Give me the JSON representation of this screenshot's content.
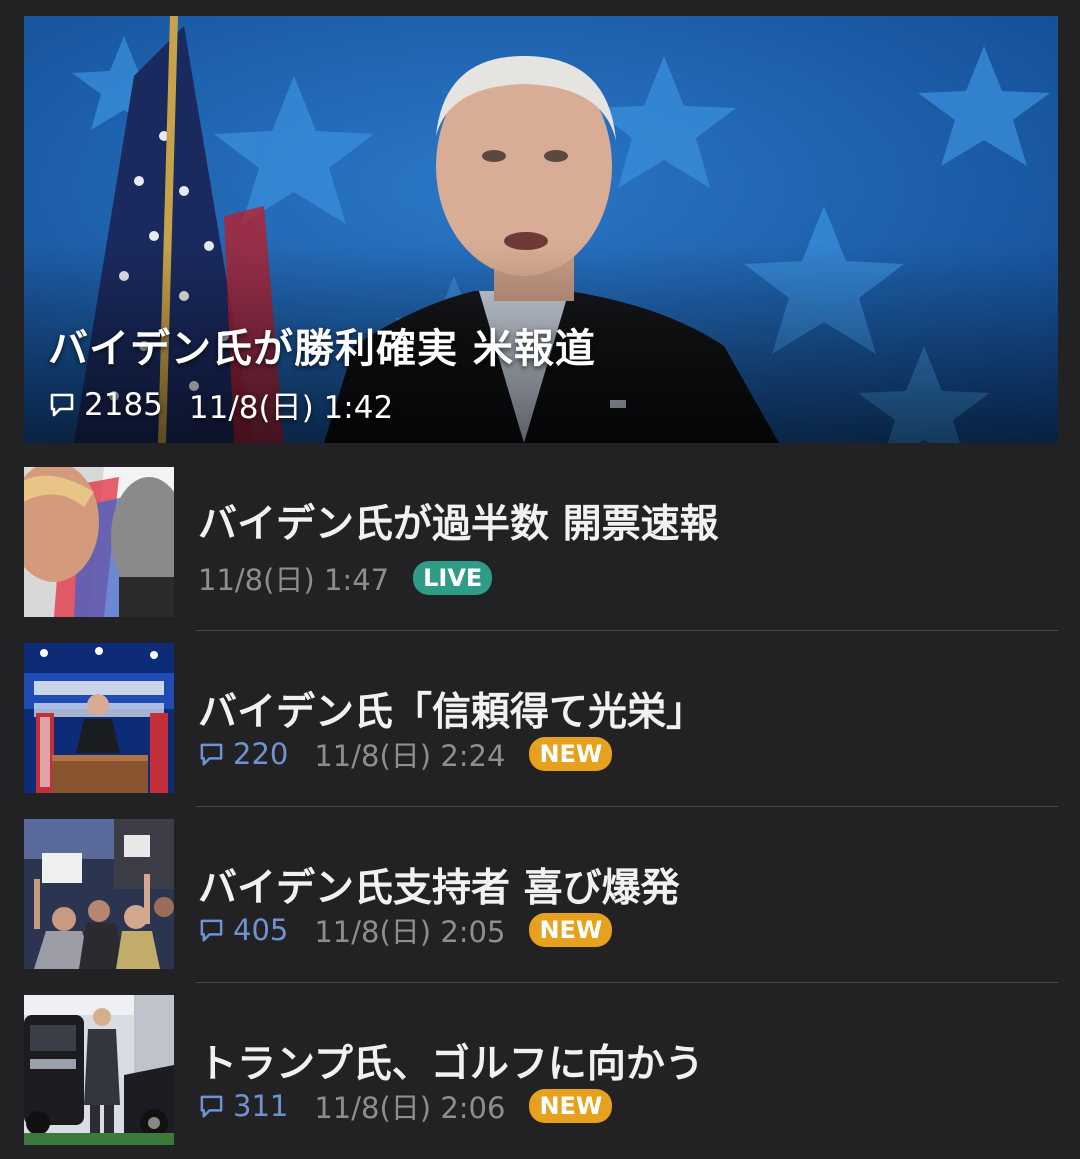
{
  "hero": {
    "title": "バイデン氏が勝利確実 米報道",
    "comments": "2185",
    "time": "11/8(日) 1:42",
    "comment_icon": "speech-bubble-icon"
  },
  "items": [
    {
      "title": "バイデン氏が過半数 開票速報",
      "comments": "",
      "time": "11/8(日) 1:47",
      "badge": "LIVE",
      "thumb": "trump-biden-faceoff"
    },
    {
      "title": "バイデン氏「信頼得て光栄」",
      "comments": "220",
      "time": "11/8(日) 2:24",
      "badge": "NEW",
      "thumb": "biden-harris-podium"
    },
    {
      "title": "バイデン氏支持者 喜び爆発",
      "comments": "405",
      "time": "11/8(日) 2:05",
      "badge": "NEW",
      "thumb": "supporters-crowd"
    },
    {
      "title": "トランプ氏、ゴルフに向かう",
      "comments": "311",
      "time": "11/8(日) 2:06",
      "badge": "NEW",
      "thumb": "trump-car-golf"
    }
  ],
  "colors": {
    "background": "#222224",
    "comment_count": "#6f93cf",
    "live_badge": "#2e9c88",
    "new_badge": "#e6a21f",
    "timestamp": "#8d8d92"
  }
}
